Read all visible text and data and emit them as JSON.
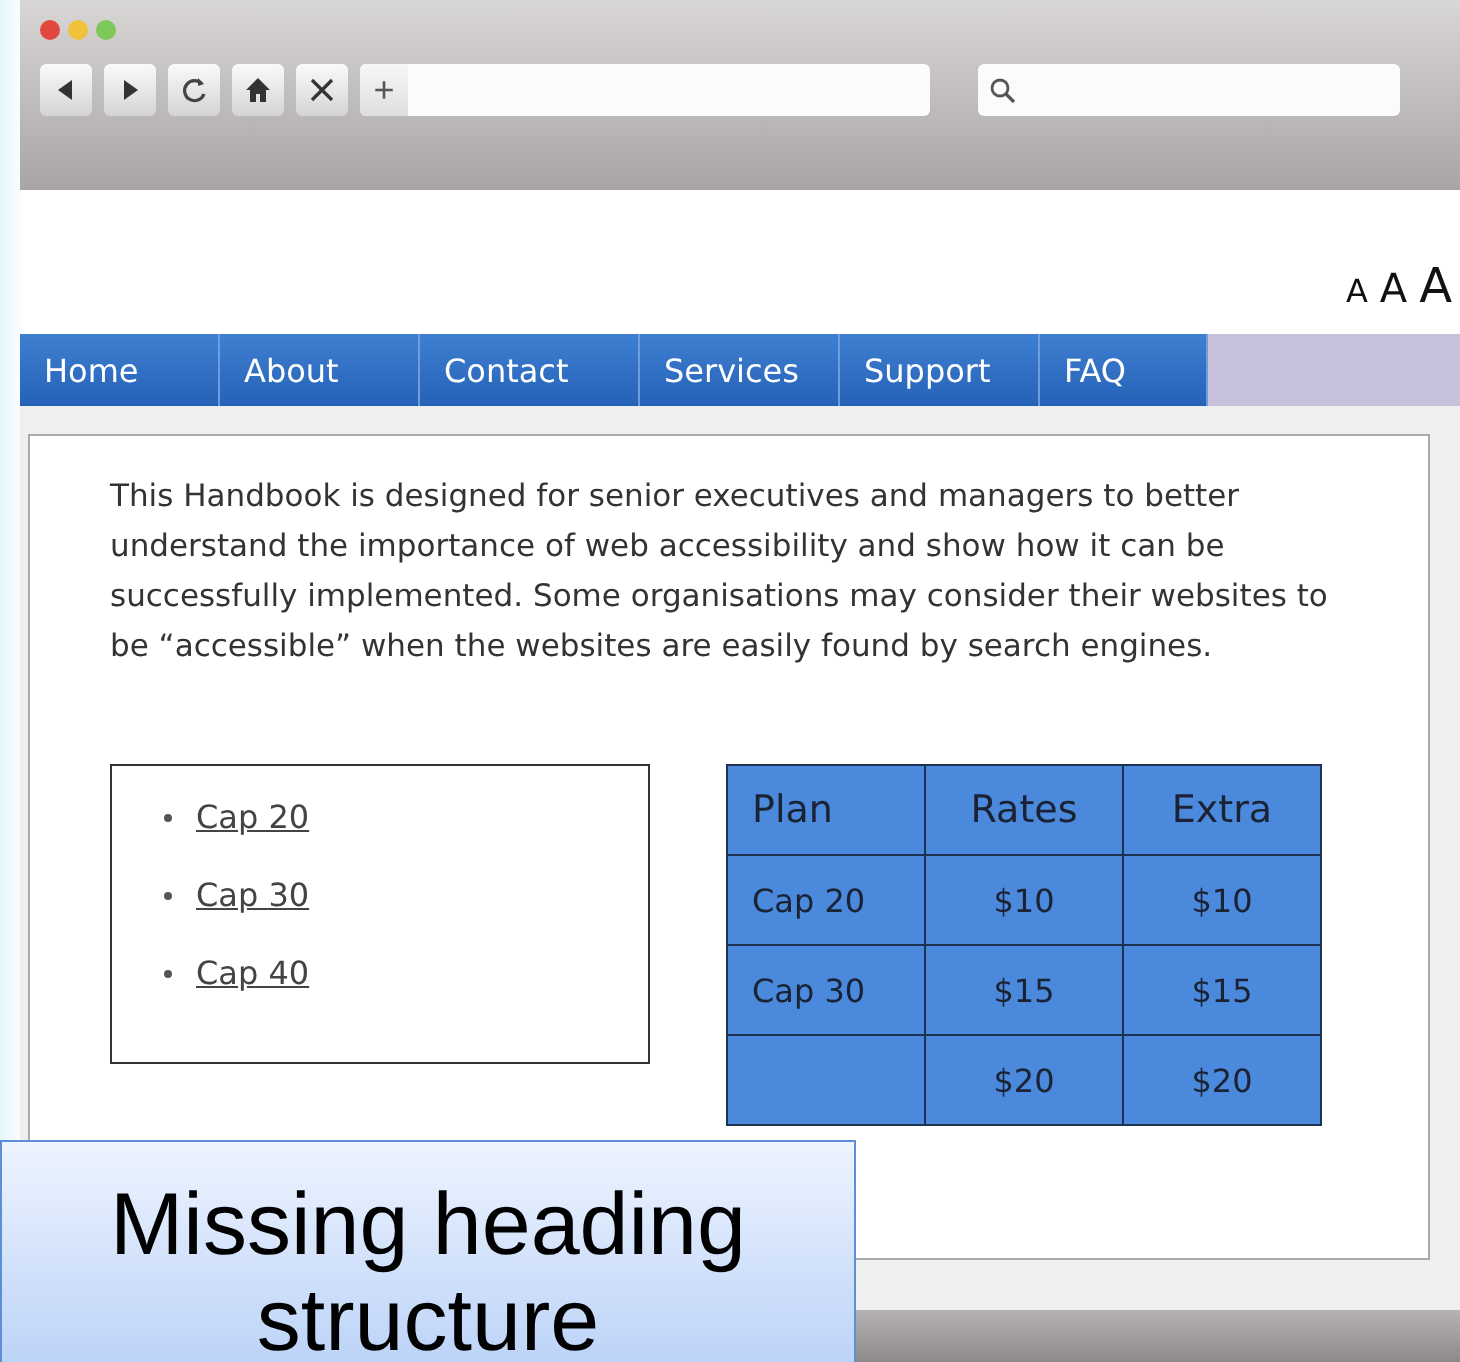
{
  "toolbar": {
    "buttons": [
      {
        "kind": "back"
      },
      {
        "kind": "forward"
      },
      {
        "kind": "reload"
      },
      {
        "kind": "home"
      },
      {
        "kind": "stop"
      }
    ],
    "new_tab": "+"
  },
  "text_size": [
    "A",
    "A",
    "A"
  ],
  "nav": [
    {
      "label": "Home"
    },
    {
      "label": "About"
    },
    {
      "label": "Contact"
    },
    {
      "label": "Services"
    },
    {
      "label": "Support"
    },
    {
      "label": "FAQ"
    }
  ],
  "intro": "This Handbook is designed for senior executives and managers to better understand the importance of web accessibility and show how it can be successfully implemented. Some organisations may consider their websites to be “accessible” when the websites are easily found by search engines.",
  "links": [
    "Cap 20",
    "Cap 30",
    "Cap 40"
  ],
  "table": {
    "columns": [
      "Plan",
      "Rates",
      "Extra"
    ],
    "rows": [
      [
        "Cap 20",
        "$10",
        "$10"
      ],
      [
        "Cap 30",
        "$15",
        "$15"
      ],
      [
        "",
        "$20",
        "$20"
      ]
    ]
  },
  "caption": "Missing heading structure"
}
